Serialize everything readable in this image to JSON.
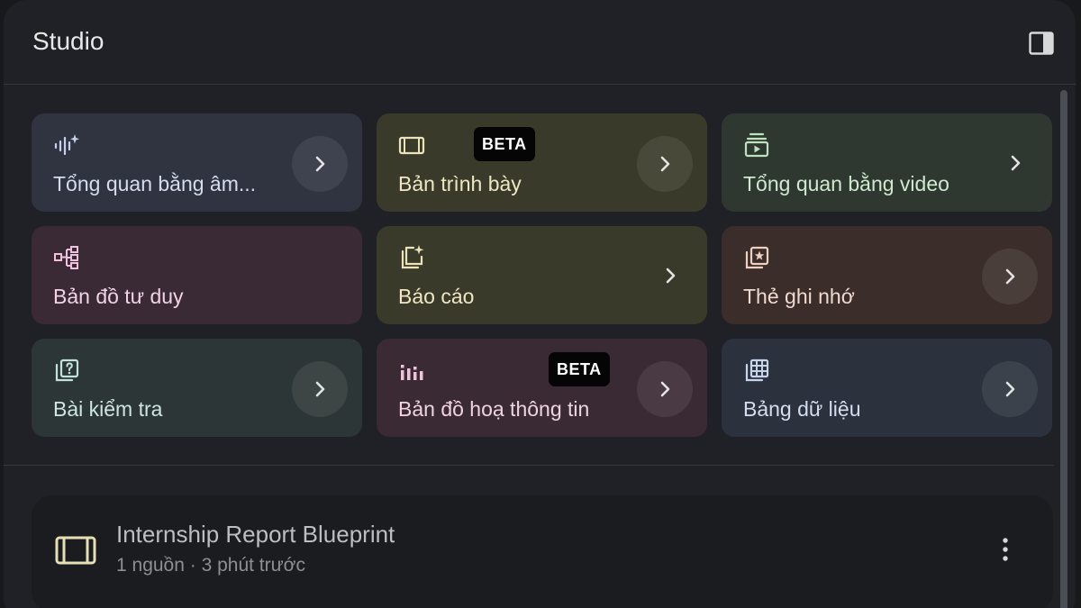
{
  "panel": {
    "title": "Studio",
    "collapse_icon": "panel-right-icon"
  },
  "cards": [
    {
      "label": "Tổng quan bằng âm...",
      "icon": "audio-sparkle-icon",
      "theme": "blue",
      "accent": "#c6d0ea"
    },
    {
      "label": "Bản trình bày",
      "icon": "slides-icon",
      "theme": "olive",
      "accent": "#ece3b8",
      "badge": "BETA"
    },
    {
      "label": "Tổng quan bằng video",
      "icon": "video-play-icon",
      "theme": "green",
      "accent": "#bde3bd"
    },
    {
      "label": "Bản đồ tư duy",
      "icon": "mind-map-icon",
      "theme": "pink",
      "accent": "#eec2dd"
    },
    {
      "label": "Báo cáo",
      "icon": "report-sparkle-icon",
      "theme": "olive",
      "accent": "#ece3b8"
    },
    {
      "label": "Thẻ ghi nhớ",
      "icon": "flashcard-icon",
      "theme": "brown",
      "accent": "#efcfc0"
    },
    {
      "label": "Bài kiểm tra",
      "icon": "quiz-icon",
      "theme": "teal",
      "accent": "#c1e2de"
    },
    {
      "label": "Bản đồ hoạ thông tin",
      "icon": "infographic-icon",
      "theme": "plum",
      "accent": "#efc3dc",
      "badge": "BETA"
    },
    {
      "label": "Bảng dữ liệu",
      "icon": "data-table-icon",
      "theme": "slate",
      "accent": "#c6d4ee"
    }
  ],
  "note": {
    "title": "Internship Report Blueprint",
    "meta": "1 nguồn · 3 phút trước",
    "icon": "slides-icon",
    "accent": "#e6dfb4"
  }
}
